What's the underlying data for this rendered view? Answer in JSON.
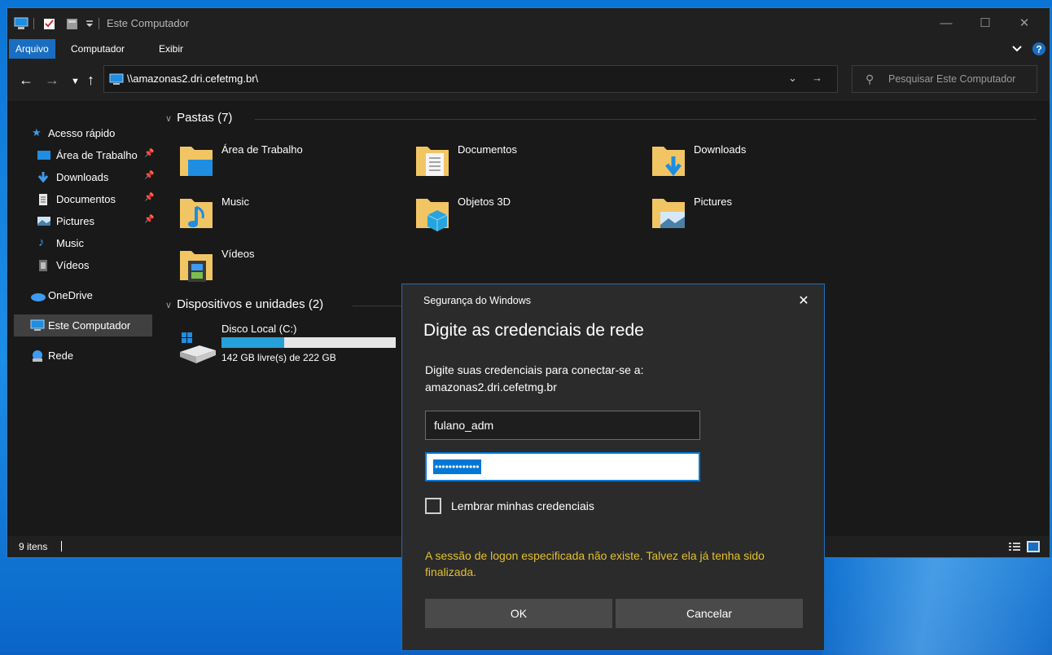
{
  "window": {
    "title": "Este Computador"
  },
  "ribbon": {
    "tabs": [
      {
        "label": "Arquivo"
      },
      {
        "label": "Computador"
      },
      {
        "label": "Exibir"
      }
    ]
  },
  "nav": {
    "address": "\\\\amazonas2.dri.cefetmg.br\\",
    "search_placeholder": "Pesquisar Este Computador"
  },
  "sidebar": {
    "items": [
      {
        "label": "Acesso rápido"
      },
      {
        "label": "Área de Trabalho"
      },
      {
        "label": "Downloads"
      },
      {
        "label": "Documentos"
      },
      {
        "label": "Pictures"
      },
      {
        "label": "Music"
      },
      {
        "label": "Vídeos"
      },
      {
        "label": "OneDrive"
      },
      {
        "label": "Este Computador"
      },
      {
        "label": "Rede"
      }
    ]
  },
  "content": {
    "folders_header": "Pastas (7)",
    "folders": [
      {
        "label": "Área de Trabalho"
      },
      {
        "label": "Documentos"
      },
      {
        "label": "Downloads"
      },
      {
        "label": "Music"
      },
      {
        "label": "Objetos 3D"
      },
      {
        "label": "Pictures"
      },
      {
        "label": "Vídeos"
      }
    ],
    "devices_header": "Dispositivos e unidades (2)",
    "drive": {
      "name": "Disco Local (C:)",
      "free_text": "142 GB livre(s) de 222 GB",
      "used_fraction": 0.36
    }
  },
  "status": {
    "count": "9 itens"
  },
  "dialog": {
    "caption": "Segurança do Windows",
    "title": "Digite as credenciais de rede",
    "prompt": "Digite suas credenciais para conectar-se a:",
    "server": "amazonas2.dri.cefetmg.br",
    "username": "fulano_adm",
    "password_mask": "•••••••••••••",
    "remember_label": "Lembrar minhas credenciais",
    "error": "A sessão de logon especificada não existe. Talvez ela já tenha sido finalizada.",
    "ok_label": "OK",
    "cancel_label": "Cancelar"
  },
  "colors": {
    "accent": "#1a6ec2",
    "folder": "#f2c564",
    "error_text": "#e3c12b"
  }
}
